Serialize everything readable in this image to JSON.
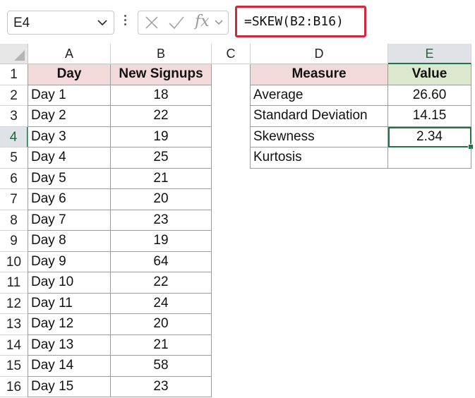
{
  "formula_bar": {
    "name_box": "E4",
    "formula": "=SKEW(B2:B16)",
    "fx_label": "fx"
  },
  "columns": [
    "A",
    "B",
    "C",
    "D",
    "E"
  ],
  "active_column": "E",
  "active_row": "4",
  "rows": [
    "1",
    "2",
    "3",
    "4",
    "5",
    "6",
    "7",
    "8",
    "9",
    "10",
    "11",
    "12",
    "13",
    "14",
    "15",
    "16"
  ],
  "table1": {
    "header": [
      "Day",
      "New Signups"
    ],
    "rows": [
      [
        "Day 1",
        "18"
      ],
      [
        "Day 2",
        "22"
      ],
      [
        "Day 3",
        "19"
      ],
      [
        "Day 4",
        "25"
      ],
      [
        "Day 5",
        "21"
      ],
      [
        "Day 6",
        "20"
      ],
      [
        "Day 7",
        "23"
      ],
      [
        "Day 8",
        "19"
      ],
      [
        "Day 9",
        "64"
      ],
      [
        "Day 10",
        "22"
      ],
      [
        "Day 11",
        "24"
      ],
      [
        "Day 12",
        "20"
      ],
      [
        "Day 13",
        "21"
      ],
      [
        "Day 14",
        "58"
      ],
      [
        "Day 15",
        "23"
      ]
    ]
  },
  "table2": {
    "header": [
      "Measure",
      "Value"
    ],
    "rows": [
      [
        "Average",
        "26.60"
      ],
      [
        "Standard Deviation",
        "14.15"
      ],
      [
        "Skewness",
        "2.34"
      ],
      [
        "Kurtosis",
        ""
      ]
    ]
  },
  "colors": {
    "pink_header": "#f3dada",
    "green_header": "#dbe8cd",
    "selection": "#217346",
    "formula_highlight": "#d0283f"
  }
}
